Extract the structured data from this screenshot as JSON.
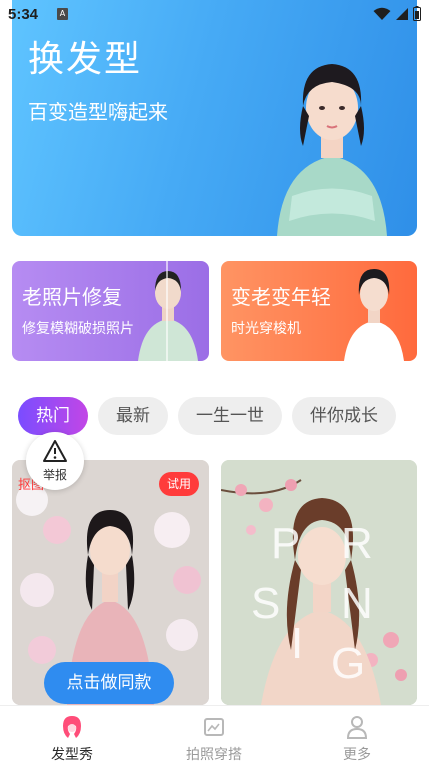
{
  "status_bar": {
    "time": "5:34",
    "notification_letter": "A"
  },
  "hero": {
    "title": "换发型",
    "subtitle": "百变造型嗨起来"
  },
  "features": [
    {
      "title": "老照片修复",
      "subtitle": "修复模糊破损照片"
    },
    {
      "title": "变老变年轻",
      "subtitle": "时光穿梭机"
    }
  ],
  "tabs": [
    {
      "label": "热门",
      "active": true
    },
    {
      "label": "最新",
      "active": false
    },
    {
      "label": "一生一世",
      "active": false
    },
    {
      "label": "伴你成长",
      "active": false
    }
  ],
  "report": {
    "label": "举报"
  },
  "content_cards": [
    {
      "tag": "抠图",
      "badge": "试用",
      "cta": "点击做同款"
    },
    {
      "overlay_letters": [
        "S",
        "P",
        "R",
        "I",
        "N",
        "G"
      ]
    }
  ],
  "bottom_nav": [
    {
      "label": "发型秀",
      "icon": "hairstyle-icon",
      "active": true
    },
    {
      "label": "拍照穿搭",
      "icon": "photo-outfit-icon",
      "active": false
    },
    {
      "label": "更多",
      "icon": "more-user-icon",
      "active": false
    }
  ],
  "colors": {
    "hero_gradient_start": "#5fc4ff",
    "hero_gradient_end": "#2f8fe8",
    "purple_card": "#9b6ee6",
    "orange_card": "#ff6a3d",
    "active_tab_start": "#7a4dff",
    "active_tab_end": "#c246e6",
    "cta_blue": "#2f8cf0",
    "badge_red": "#ff3b3b",
    "nav_active": "#ff4d79"
  }
}
